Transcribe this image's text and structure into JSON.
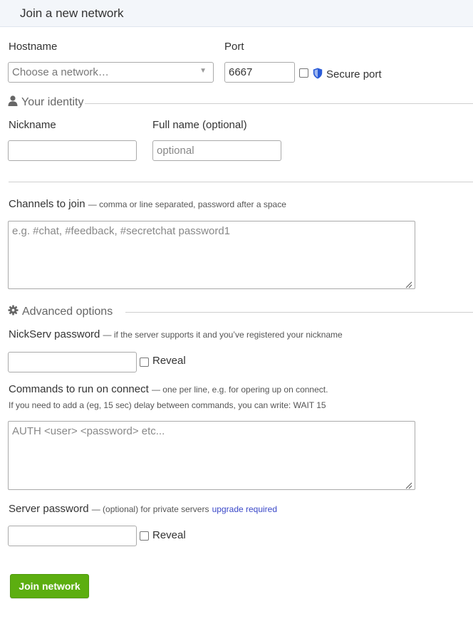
{
  "header": {
    "title": "Join a new network"
  },
  "server": {
    "hostname_label": "Hostname",
    "hostname_placeholder": "Choose a network…",
    "port_label": "Port",
    "port_value": "6667",
    "secure_port_label": "Secure port"
  },
  "identity": {
    "legend": "Your identity",
    "nickname_label": "Nickname",
    "nickname_value": "",
    "fullname_label": "Full name (optional)",
    "fullname_placeholder": "optional"
  },
  "channels": {
    "label": "Channels to join",
    "hint": "— comma or line separated, password after a space",
    "placeholder": "e.g. #chat, #feedback, #secretchat password1"
  },
  "advanced": {
    "legend": "Advanced options",
    "nickserv_label": "NickServ password",
    "nickserv_hint": "— if the server supports it and you’ve registered your nickname",
    "nickserv_reveal_label": "Reveal",
    "commands_label": "Commands to run on connect",
    "commands_hint": "— one per line, e.g. for opering up on connect.",
    "commands_note": "If you need to add a (eg, 15 sec) delay between commands, you can write: WAIT 15",
    "commands_placeholder": "AUTH <user> <password> etc...",
    "server_password_label": "Server password",
    "server_password_hint": "— (optional) for private servers",
    "server_password_link": "upgrade required",
    "server_reveal_label": "Reveal"
  },
  "actions": {
    "join_label": "Join network"
  },
  "icons": {
    "shield": "shield-icon",
    "user": "user-icon",
    "gear": "gear-icon",
    "dropdown": "chevron-down-icon"
  },
  "colors": {
    "accent_green": "#5cae10",
    "link_blue": "#3a48c8",
    "shield_blue": "#2a5bd7"
  }
}
